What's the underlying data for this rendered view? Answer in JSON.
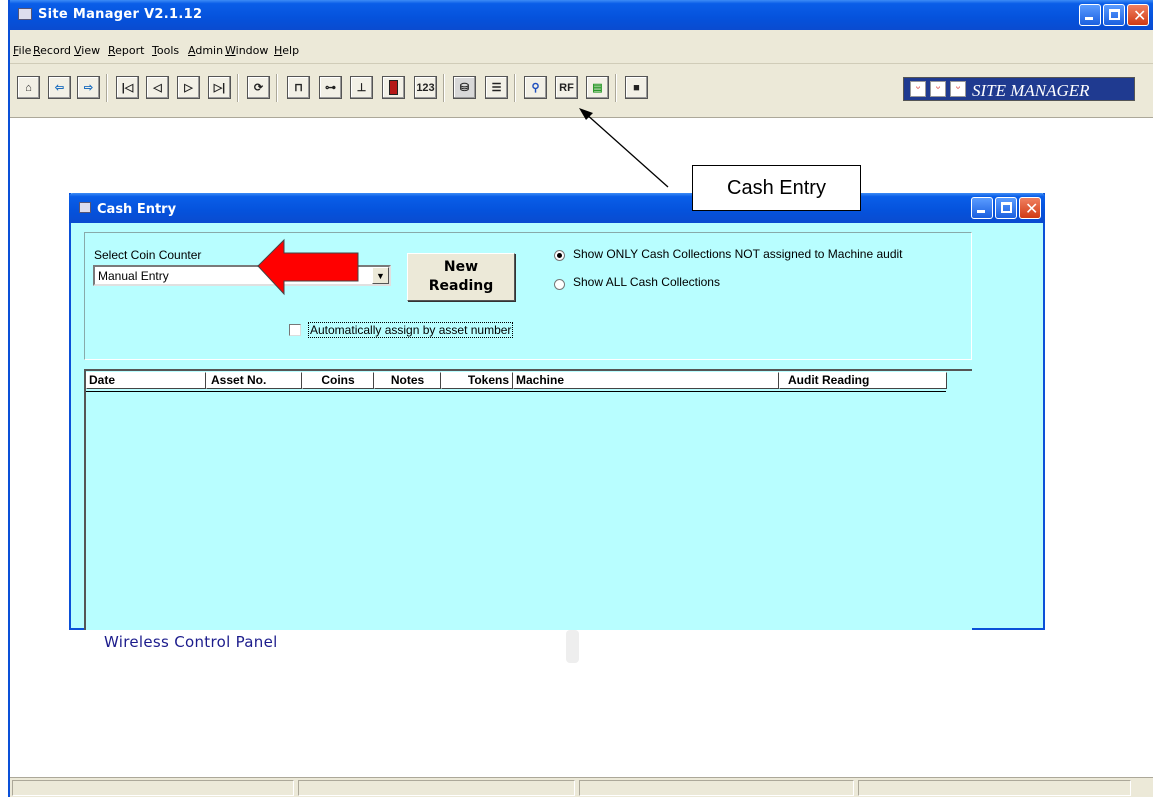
{
  "window": {
    "title": "Site Manager  V2.1.12"
  },
  "menu": [
    "File",
    "Record",
    "View",
    "Report",
    "Tools",
    "Admin",
    "Window",
    "Help"
  ],
  "toolbar": {
    "icons": [
      "home-icon",
      "back-arrow-icon",
      "forward-arrow-icon",
      "first-record-icon",
      "previous-record-icon",
      "next-record-icon",
      "last-record-icon",
      "refresh-icon",
      "ruler-icon",
      "ruler-mid-icon",
      "ruler-low-icon",
      "battery-icon",
      "numeric-icon",
      "cash-entry-icon",
      "report-icon",
      "search-icon",
      "rf-icon",
      "chart-icon",
      "save-icon"
    ],
    "labels": {
      "numeric": "123",
      "rf": "RF"
    },
    "brand": "SITE MANAGER"
  },
  "cash_entry": {
    "title": "Cash Entry",
    "select_label": "Select Coin Counter",
    "select_value": "Manual Entry",
    "new_reading": [
      "New",
      "Reading"
    ],
    "auto_assign_label": "Automatically assign by asset number",
    "auto_assign_checked": false,
    "radio_options": [
      {
        "label": "Show ONLY Cash Collections NOT assigned to Machine audit",
        "selected": true
      },
      {
        "label": "Show ALL Cash Collections",
        "selected": false
      }
    ],
    "columns": [
      "Date",
      "Asset No.",
      "Coins",
      "Notes",
      "Tokens",
      "Machine",
      "Audit Reading"
    ],
    "rows": []
  },
  "annotation": {
    "callout": "Cash Entry"
  },
  "background_label": "Wireless Control Panel",
  "colors": {
    "titlebar": "#0552dc",
    "dialog_bg": "#b8feff",
    "arrow": "#ff0000",
    "chrome": "#ece9d8"
  }
}
